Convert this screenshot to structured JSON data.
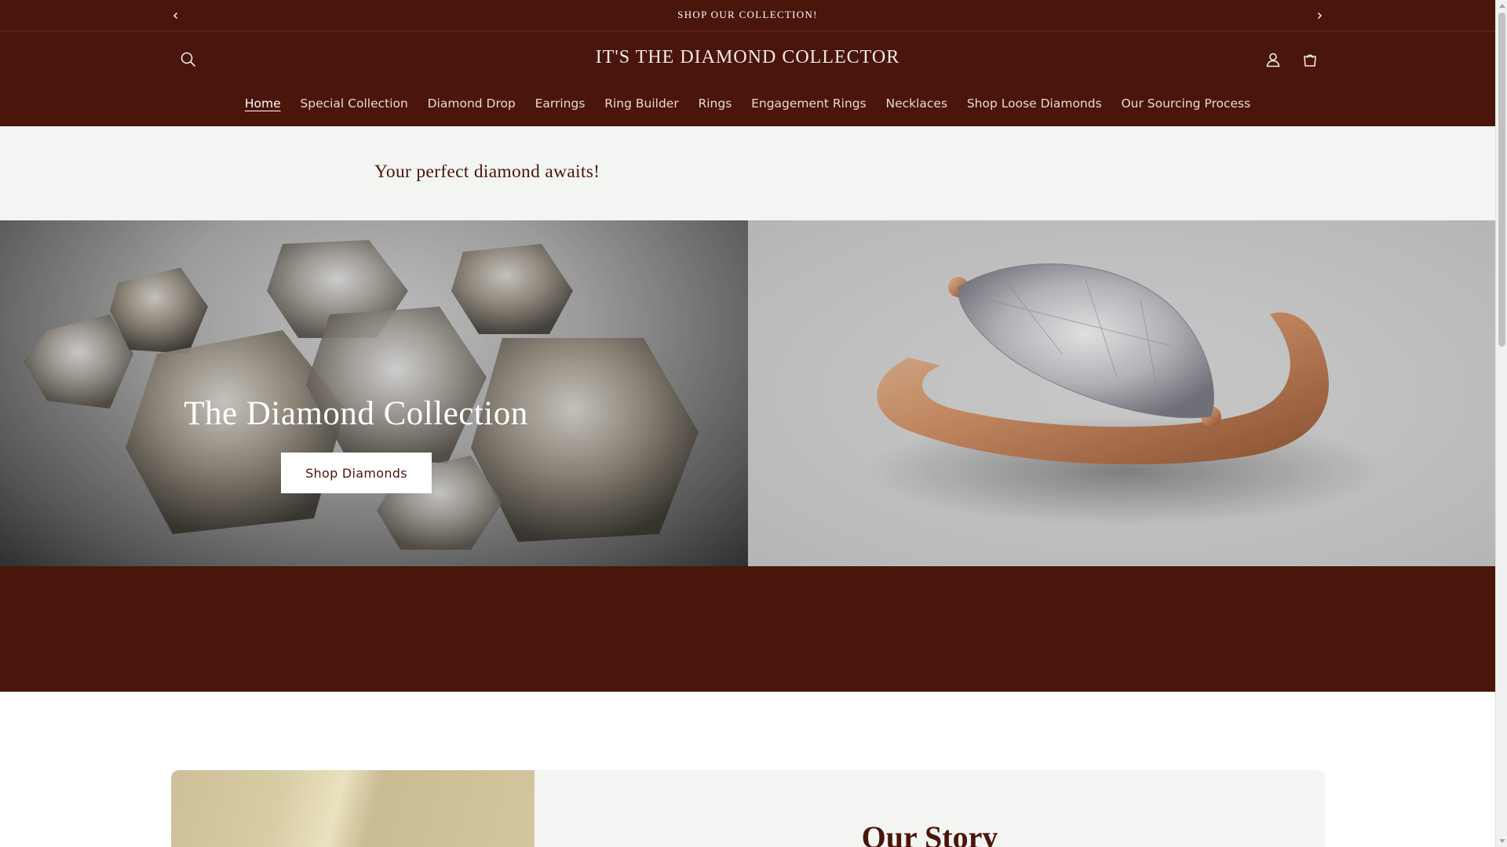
{
  "announcement": {
    "message": "SHOP OUR COLLECTION!",
    "prev_icon": "chevron-left-icon",
    "next_icon": "chevron-right-icon"
  },
  "header": {
    "logo": "IT'S THE DIAMOND COLLECTOR",
    "icons": [
      "search-icon",
      "account-icon",
      "cart-icon"
    ],
    "nav": [
      {
        "label": "Home",
        "active": true
      },
      {
        "label": "Special Collection",
        "active": false
      },
      {
        "label": "Diamond Drop",
        "active": false
      },
      {
        "label": "Earrings",
        "active": false
      },
      {
        "label": "Ring Builder",
        "active": false
      },
      {
        "label": "Rings",
        "active": false
      },
      {
        "label": "Engagement Rings",
        "active": false
      },
      {
        "label": "Necklaces",
        "active": false
      },
      {
        "label": "Shop Loose Diamonds",
        "active": false
      },
      {
        "label": "Our Sourcing Process",
        "active": false
      }
    ]
  },
  "tagline": "Your perfect diamond awaits!",
  "hero": {
    "title": "The Diamond Collection",
    "button_label": "Shop Diamonds"
  },
  "story": {
    "title": "Our Story"
  },
  "colors": {
    "brand_maroon": "#4a150b",
    "light_band": "#f3f5f2",
    "nav_text": "#ead9d2"
  }
}
